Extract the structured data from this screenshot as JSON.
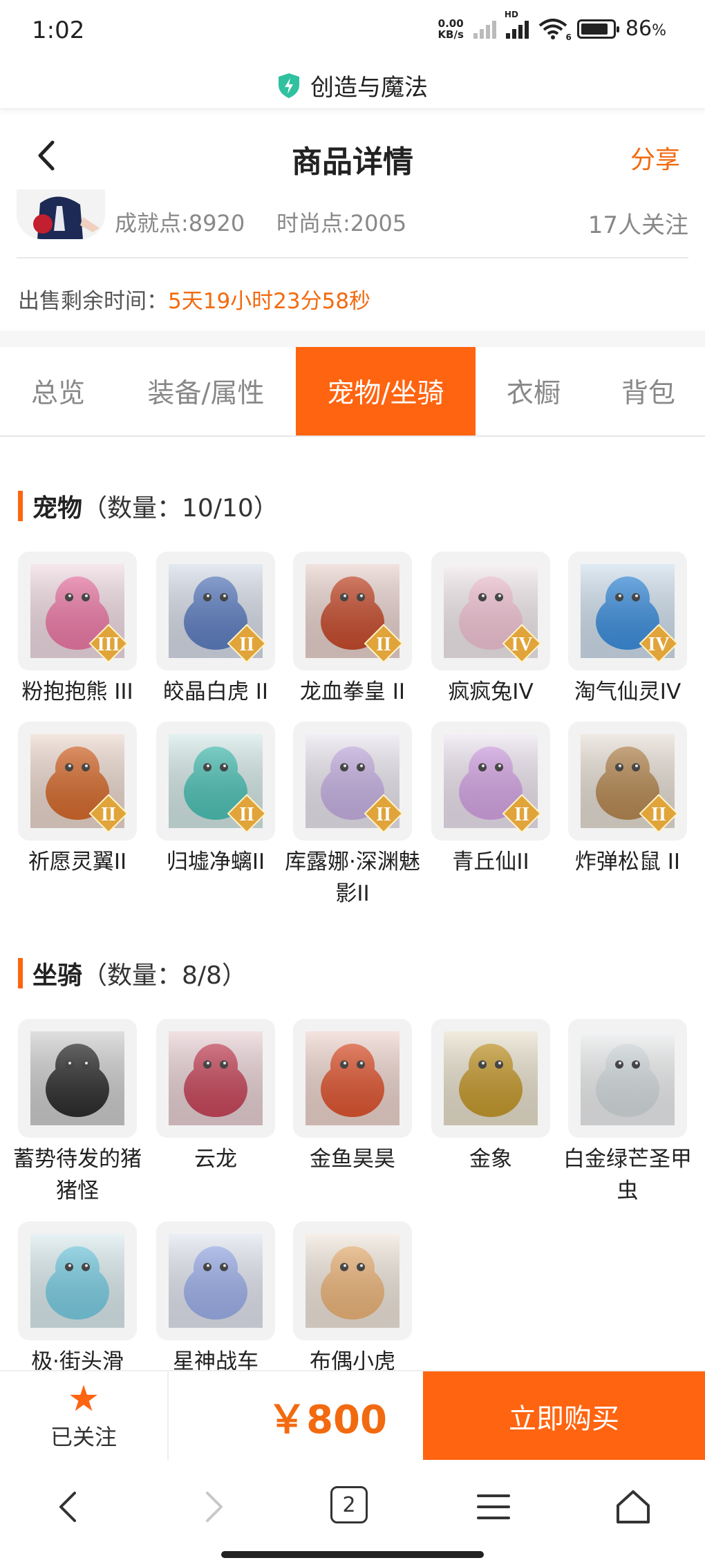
{
  "status_bar": {
    "time": "1:02",
    "net_speed_value": "0.00",
    "net_speed_unit": "KB/s",
    "hd": "HD",
    "wifi_badge": "6",
    "battery_percent": "86",
    "battery_suffix": "%"
  },
  "site": {
    "name": "创造与魔法",
    "icon": "shield-bolt-icon",
    "accent": "#2fc1a0"
  },
  "header": {
    "title": "商品详情",
    "share": "分享"
  },
  "seller": {
    "achievement": "成就点:8920",
    "fashion": "时尚点:2005",
    "followers": "17人关注"
  },
  "sale": {
    "remain_label": "出售剩余时间：",
    "remain_value": "5天19小时23分58秒"
  },
  "tabs": [
    {
      "label": "总览",
      "active": false
    },
    {
      "label": "装备/属性",
      "active": false
    },
    {
      "label": "宠物/坐骑",
      "active": true
    },
    {
      "label": "衣橱",
      "active": false
    },
    {
      "label": "背包",
      "active": false
    }
  ],
  "pets": {
    "title": "宠物",
    "count": "（数量：10/10）",
    "items": [
      {
        "name": "粉抱抱熊 III",
        "grade": "III",
        "color": "#f07aa8"
      },
      {
        "name": "皎晶白虎 II",
        "grade": "II",
        "color": "#5d7fc4"
      },
      {
        "name": "龙血拳皇 II",
        "grade": "II",
        "color": "#c84a2a"
      },
      {
        "name": "疯疯兔IV",
        "grade": "IV",
        "color": "#f6c7d8"
      },
      {
        "name": "淘气仙灵IV",
        "grade": "IV",
        "color": "#3a8fe0"
      },
      {
        "name": "祈愿灵翼II",
        "grade": "II",
        "color": "#d96a2a"
      },
      {
        "name": "归墟净螭II",
        "grade": "II",
        "color": "#4cc4b8"
      },
      {
        "name": "库露娜·深渊魅影II",
        "grade": "II",
        "color": "#c9b3e6"
      },
      {
        "name": "青丘仙II",
        "grade": "II",
        "color": "#d7a6e8"
      },
      {
        "name": "炸弹松鼠 II",
        "grade": "II",
        "color": "#b98a52"
      }
    ]
  },
  "mounts": {
    "title": "坐骑",
    "count": "（数量：8/8）",
    "items": [
      {
        "name": "蓄势待发的猪猪怪",
        "color": "#2a2a2a"
      },
      {
        "name": "云龙",
        "color": "#c9455a"
      },
      {
        "name": "金鱼昊昊",
        "color": "#e2542e"
      },
      {
        "name": "金象",
        "color": "#c79a2a"
      },
      {
        "name": "白金绿芒圣甲虫",
        "color": "#d8dfe2"
      },
      {
        "name": "极·街头滑",
        "color": "#7ad0e6"
      },
      {
        "name": "星神战车",
        "color": "#9fb2ee"
      },
      {
        "name": "布偶小虎",
        "color": "#f0b77a"
      }
    ]
  },
  "bottom_bar": {
    "followed_label": "已关注",
    "price": "￥800",
    "buy_label": "立即购买"
  },
  "nav": {
    "tabs_count": "2"
  },
  "colors": {
    "accent": "#ff6410",
    "accent_text": "#f26a10"
  }
}
